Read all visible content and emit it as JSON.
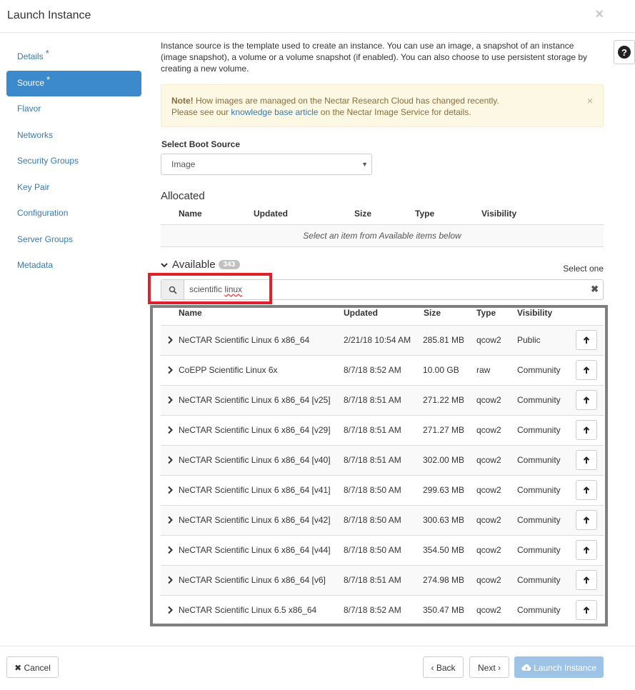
{
  "modal": {
    "title": "Launch Instance",
    "close_icon": "×"
  },
  "sidebar": {
    "items": [
      {
        "label": "Details",
        "required": "*",
        "active": false
      },
      {
        "label": "Source",
        "required": "*",
        "active": true
      },
      {
        "label": "Flavor",
        "required": "",
        "active": false
      },
      {
        "label": "Networks",
        "required": "",
        "active": false
      },
      {
        "label": "Security Groups",
        "required": "",
        "active": false
      },
      {
        "label": "Key Pair",
        "required": "",
        "active": false
      },
      {
        "label": "Configuration",
        "required": "",
        "active": false
      },
      {
        "label": "Server Groups",
        "required": "",
        "active": false
      },
      {
        "label": "Metadata",
        "required": "",
        "active": false
      }
    ]
  },
  "source": {
    "help_text": "Instance source is the template used to create an instance. You can use an image, a snapshot of an instance (image snapshot), a volume or a volume snapshot (if enabled). You can also choose to use persistent storage by creating a new volume.",
    "help_icon": "?",
    "note": {
      "strong": "Note!",
      "line1": " How images are managed on the Nectar Research Cloud has changed recently.",
      "line2_pre": "Please see our ",
      "link": "knowledge base article",
      "line2_post": " on the Nectar Image Service for details.",
      "close": "×"
    },
    "boot_source_label": "Select Boot Source",
    "boot_source_value": "Image",
    "allocated": {
      "title": "Allocated",
      "columns": [
        "Name",
        "Updated",
        "Size",
        "Type",
        "Visibility"
      ],
      "empty_text": "Select an item from Available items below"
    },
    "available": {
      "title": "Available",
      "count": "343",
      "select_one": "Select one",
      "search_value_1": "scientific ",
      "search_value_2": "linux",
      "search_clear": "✖",
      "columns": [
        "Name",
        "Updated",
        "Size",
        "Type",
        "Visibility"
      ],
      "rows": [
        {
          "name": "NeCTAR Scientific Linux 6 x86_64",
          "updated": "2/21/18 10:54 AM",
          "size": "285.81 MB",
          "type": "qcow2",
          "visibility": "Public"
        },
        {
          "name": "CoEPP Scientific Linux 6x",
          "updated": "8/7/18 8:52 AM",
          "size": "10.00 GB",
          "type": "raw",
          "visibility": "Community"
        },
        {
          "name": "NeCTAR Scientific Linux 6 x86_64 [v25]",
          "updated": "8/7/18 8:51 AM",
          "size": "271.22 MB",
          "type": "qcow2",
          "visibility": "Community"
        },
        {
          "name": "NeCTAR Scientific Linux 6 x86_64 [v29]",
          "updated": "8/7/18 8:51 AM",
          "size": "271.27 MB",
          "type": "qcow2",
          "visibility": "Community"
        },
        {
          "name": "NeCTAR Scientific Linux 6 x86_64 [v40]",
          "updated": "8/7/18 8:51 AM",
          "size": "302.00 MB",
          "type": "qcow2",
          "visibility": "Community"
        },
        {
          "name": "NeCTAR Scientific Linux 6 x86_64 [v41]",
          "updated": "8/7/18 8:50 AM",
          "size": "299.63 MB",
          "type": "qcow2",
          "visibility": "Community"
        },
        {
          "name": "NeCTAR Scientific Linux 6 x86_64 [v42]",
          "updated": "8/7/18 8:50 AM",
          "size": "300.63 MB",
          "type": "qcow2",
          "visibility": "Community"
        },
        {
          "name": "NeCTAR Scientific Linux 6 x86_64 [v44]",
          "updated": "8/7/18 8:50 AM",
          "size": "354.50 MB",
          "type": "qcow2",
          "visibility": "Community"
        },
        {
          "name": "NeCTAR Scientific Linux 6 x86_64 [v6]",
          "updated": "8/7/18 8:51 AM",
          "size": "274.98 MB",
          "type": "qcow2",
          "visibility": "Community"
        },
        {
          "name": "NeCTAR Scientific Linux 6.5 x86_64",
          "updated": "8/7/18 8:52 AM",
          "size": "350.47 MB",
          "type": "qcow2",
          "visibility": "Community"
        }
      ]
    }
  },
  "footer": {
    "cancel_label": "Cancel",
    "back_label": "Back",
    "next_label": "Next",
    "launch_label": "Launch Instance"
  },
  "colors": {
    "accent": "#3c89cb",
    "link": "#337ab7",
    "highlight_red": "#e0202a",
    "highlight_gray": "#7f7f7f",
    "launch_disabled": "#9dc3e6"
  },
  "icons": {
    "search": "search-icon",
    "expand": "chevron-right-icon",
    "allocate": "arrow-up-icon",
    "cancel": "times-icon",
    "back": "chevron-left-icon",
    "next": "chevron-right-icon",
    "launch": "cloud-upload-icon"
  }
}
